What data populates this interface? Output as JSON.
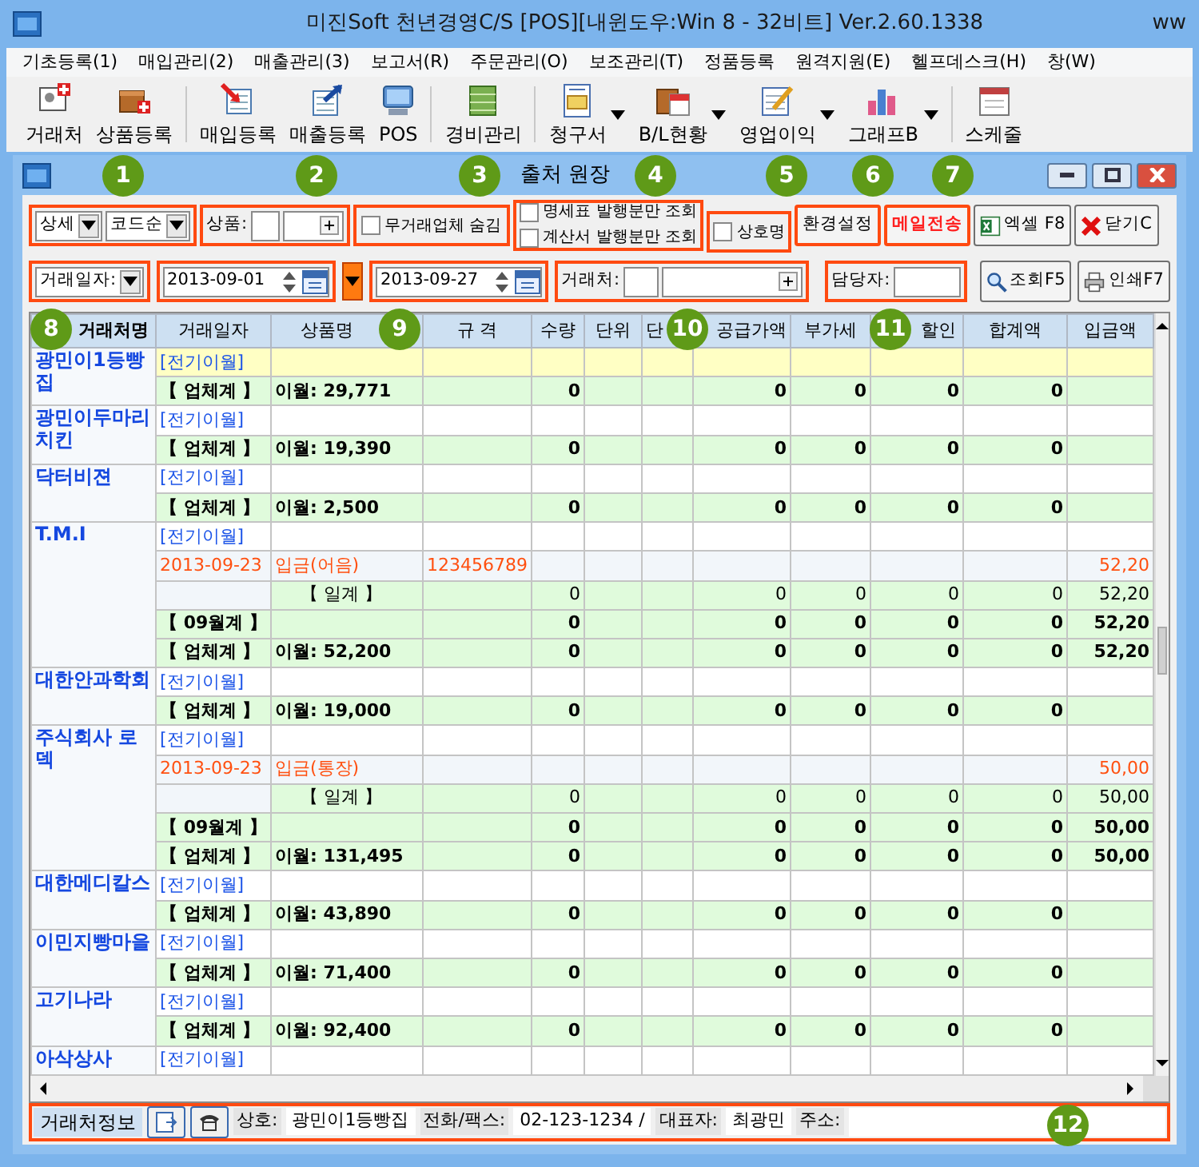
{
  "app_title": "미진Soft 천년경영C/S [POS][내윈도우:Win 8 - 32비트] Ver.2.60.1338",
  "app_title_tail": "ww",
  "menu": [
    "기초등록(1)",
    "매입관리(2)",
    "매출관리(3)",
    "보고서(R)",
    "주문관리(O)",
    "보조관리(T)",
    "정품등록",
    "원격지원(E)",
    "헬프데스크(H)",
    "창(W)"
  ],
  "toolbar": [
    {
      "label": "거래처",
      "dropdown": false,
      "separator": false
    },
    {
      "label": "상품등록",
      "dropdown": false,
      "separator": false
    },
    {
      "label": "매입등록",
      "dropdown": false,
      "separator": true
    },
    {
      "label": "매출등록",
      "dropdown": false,
      "separator": false
    },
    {
      "label": "POS",
      "dropdown": false,
      "separator": false
    },
    {
      "label": "경비관리",
      "dropdown": false,
      "separator": true
    },
    {
      "label": "청구서",
      "dropdown": true,
      "separator": true
    },
    {
      "label": "B/L현황",
      "dropdown": true,
      "separator": false
    },
    {
      "label": "영업이익",
      "dropdown": true,
      "separator": false
    },
    {
      "label": "그래프B",
      "dropdown": true,
      "separator": false
    },
    {
      "label": "스케줄",
      "dropdown": false,
      "separator": true
    }
  ],
  "window": {
    "title": "출처 원장"
  },
  "filters": {
    "view_mode": "상세",
    "sort": "코드순",
    "product_label": "상품:",
    "checks": [
      {
        "label": "무거래업체 숨김",
        "checked": false
      },
      {
        "label": "명세표 발행분만 조회",
        "checked": false
      },
      {
        "label": "계산서 발행분만 조회",
        "checked": false
      },
      {
        "label": "상호명",
        "checked": false
      }
    ],
    "date_type": "거래일자:",
    "date_from": "2013-09-01",
    "date_to": "2013-09-27",
    "client_label": "거래처:",
    "manager_label": "담당자:"
  },
  "buttons": [
    {
      "label": "환경설정",
      "kind": "plain"
    },
    {
      "label": "메일전송",
      "kind": "mail"
    },
    {
      "label": "엑셀 F8",
      "kind": "excel"
    },
    {
      "label": "닫기C",
      "kind": "close"
    }
  ],
  "search_buttons": [
    {
      "label": "조회F5",
      "kind": "search"
    },
    {
      "label": "인쇄F7",
      "kind": "print"
    }
  ],
  "table": {
    "columns": [
      "거래처명",
      "거래일자",
      "상품명",
      "규 격",
      "수량",
      "단위",
      "단",
      "공급가액",
      "부가세",
      "할인",
      "합계액",
      "입금액"
    ],
    "groups": [
      {
        "name": "광민이1등빵집",
        "selected": true,
        "rows": [
          {
            "kind": "carry",
            "date": "[전기이월]"
          },
          {
            "kind": "total",
            "date": "【 업체계 】",
            "item": "이월: 29,771",
            "qty": "0",
            "supply": "0",
            "vat": "0",
            "discount": "0",
            "sum": "0"
          }
        ]
      },
      {
        "name": "광민이두마리치킨",
        "selected": false,
        "rows": [
          {
            "kind": "carry",
            "date": "[전기이월]"
          },
          {
            "kind": "total",
            "date": "【 업체계 】",
            "item": "이월: 19,390",
            "qty": "0",
            "supply": "0",
            "vat": "0",
            "discount": "0",
            "sum": "0"
          }
        ]
      },
      {
        "name": "닥터비젼",
        "selected": false,
        "rows": [
          {
            "kind": "carry",
            "date": "[전기이월]"
          },
          {
            "kind": "total",
            "date": "【 업체계 】",
            "item": "이월: 2,500",
            "qty": "0",
            "supply": "0",
            "vat": "0",
            "discount": "0",
            "sum": "0"
          }
        ]
      },
      {
        "name": "T.M.I",
        "selected": false,
        "rows": [
          {
            "kind": "carry",
            "date": "[전기이월]"
          },
          {
            "kind": "entry",
            "date": "2013-09-23",
            "item": "입금(어음)",
            "spec": "123456789",
            "deposit": "52,20"
          },
          {
            "kind": "daily",
            "item": "【 일계 】",
            "qty": "0",
            "supply": "0",
            "vat": "0",
            "discount": "0",
            "sum": "0",
            "deposit": "52,20"
          },
          {
            "kind": "monthly",
            "date": "【 09월계 】",
            "qty": "0",
            "supply": "0",
            "vat": "0",
            "discount": "0",
            "sum": "0",
            "deposit": "52,20"
          },
          {
            "kind": "total",
            "date": "【 업체계 】",
            "item": "이월: 52,200",
            "qty": "0",
            "supply": "0",
            "vat": "0",
            "discount": "0",
            "sum": "0",
            "deposit": "52,20"
          }
        ]
      },
      {
        "name": "대한안과학회",
        "selected": false,
        "rows": [
          {
            "kind": "carry",
            "date": "[전기이월]"
          },
          {
            "kind": "total",
            "date": "【 업체계 】",
            "item": "이월: 19,000",
            "qty": "0",
            "supply": "0",
            "vat": "0",
            "discount": "0",
            "sum": "0"
          }
        ]
      },
      {
        "name": "주식회사 로덱",
        "selected": false,
        "rows": [
          {
            "kind": "carry",
            "date": "[전기이월]"
          },
          {
            "kind": "entry",
            "date": "2013-09-23",
            "item": "입금(통장)",
            "deposit": "50,00"
          },
          {
            "kind": "daily",
            "item": "【 일계 】",
            "qty": "0",
            "supply": "0",
            "vat": "0",
            "discount": "0",
            "sum": "0",
            "deposit": "50,00"
          },
          {
            "kind": "monthly",
            "date": "【 09월계 】",
            "qty": "0",
            "supply": "0",
            "vat": "0",
            "discount": "0",
            "sum": "0",
            "deposit": "50,00"
          },
          {
            "kind": "total",
            "date": "【 업체계 】",
            "item": "이월: 131,495",
            "qty": "0",
            "supply": "0",
            "vat": "0",
            "discount": "0",
            "sum": "0",
            "deposit": "50,00"
          }
        ]
      },
      {
        "name": "대한메디칼스",
        "selected": false,
        "rows": [
          {
            "kind": "carry",
            "date": "[전기이월]"
          },
          {
            "kind": "total",
            "date": "【 업체계 】",
            "item": "이월: 43,890",
            "qty": "0",
            "supply": "0",
            "vat": "0",
            "discount": "0",
            "sum": "0"
          }
        ]
      },
      {
        "name": "이민지빵마을",
        "selected": false,
        "rows": [
          {
            "kind": "carry",
            "date": "[전기이월]"
          },
          {
            "kind": "total",
            "date": "【 업체계 】",
            "item": "이월: 71,400",
            "qty": "0",
            "supply": "0",
            "vat": "0",
            "discount": "0",
            "sum": "0"
          }
        ]
      },
      {
        "name": "고기나라",
        "selected": false,
        "rows": [
          {
            "kind": "carry",
            "date": "[전기이월]"
          },
          {
            "kind": "total",
            "date": "【 업체계 】",
            "item": "이월: 92,400",
            "qty": "0",
            "supply": "0",
            "vat": "0",
            "discount": "0",
            "sum": "0"
          }
        ]
      },
      {
        "name": "아삭상사",
        "selected": false,
        "rows": [
          {
            "kind": "carry",
            "date": "[전기이월]"
          }
        ]
      }
    ]
  },
  "info_bar": {
    "title": "거래처정보",
    "fields": [
      {
        "label": "상호:",
        "value": "광민이1등빵집"
      },
      {
        "label": "전화/팩스:",
        "value": "02-123-1234 /"
      },
      {
        "label": "대표자:",
        "value": "최광민"
      },
      {
        "label": "주소:"
      }
    ]
  },
  "callouts": [
    "1",
    "2",
    "3",
    "4",
    "5",
    "6",
    "7",
    "8",
    "9",
    "10",
    "11",
    "12"
  ]
}
